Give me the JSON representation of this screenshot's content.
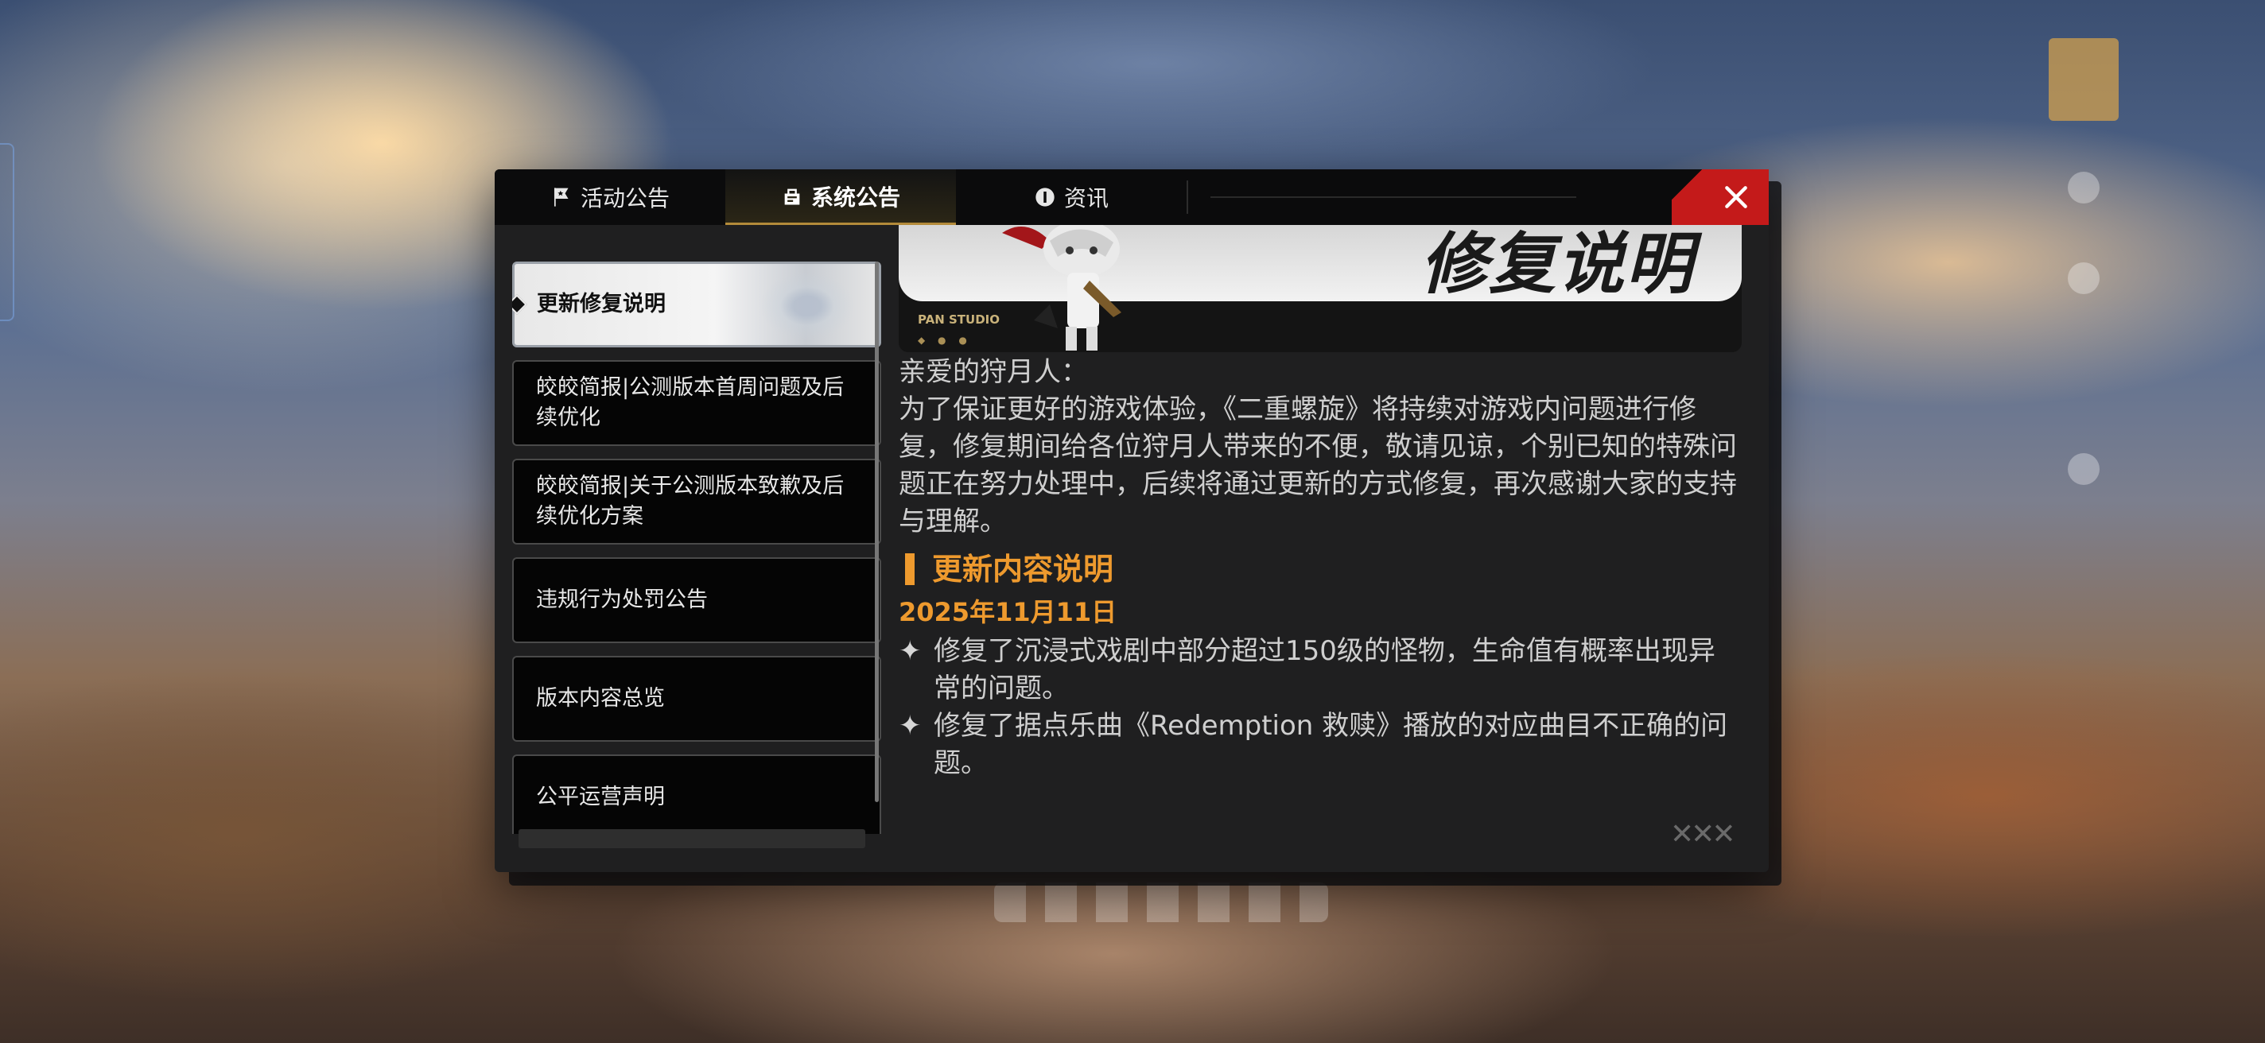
{
  "tabs": [
    {
      "label": "活动公告",
      "icon": "star-flag-icon",
      "active": false
    },
    {
      "label": "系统公告",
      "icon": "notice-board-icon",
      "active": true
    },
    {
      "label": "资讯",
      "icon": "info-icon",
      "active": false
    }
  ],
  "close_label": "✕",
  "list": {
    "items": [
      {
        "label": "更新修复说明",
        "active": true
      },
      {
        "label": "皎皎简报|公测版本首周问题及后续优化",
        "active": false
      },
      {
        "label": "皎皎简报|关于公测版本致歉及后续优化方案",
        "active": false
      },
      {
        "label": "违规行为处罚公告",
        "active": false
      },
      {
        "label": "版本内容总览",
        "active": false
      },
      {
        "label": "公平运营声明",
        "active": false
      }
    ]
  },
  "banner": {
    "title": "修复说明",
    "studio": "PAN STUDIO"
  },
  "article": {
    "greeting": "亲爱的狩月人：",
    "intro": "为了保证更好的游戏体验，《二重螺旋》将持续对游戏内问题进行修复，修复期间给各位狩月人带来的不便，敬请见谅，个别已知的特殊问题正在努力处理中，后续将通过更新的方式修复，再次感谢大家的支持与理解。",
    "section_title": "更新内容说明",
    "date": "2025年11月11日",
    "bullets": [
      "修复了沉浸式戏剧中部分超过150级的怪物，生命值有概率出现异常的问题。",
      "修复了据点乐曲《Redemption 救赎》播放的对应曲目不正确的问题。"
    ],
    "bullet_symbol": "✦"
  },
  "colors": {
    "accent": "#ee9a2e",
    "close": "#c41a1a",
    "tab_active_underline": "#b38b3a"
  }
}
